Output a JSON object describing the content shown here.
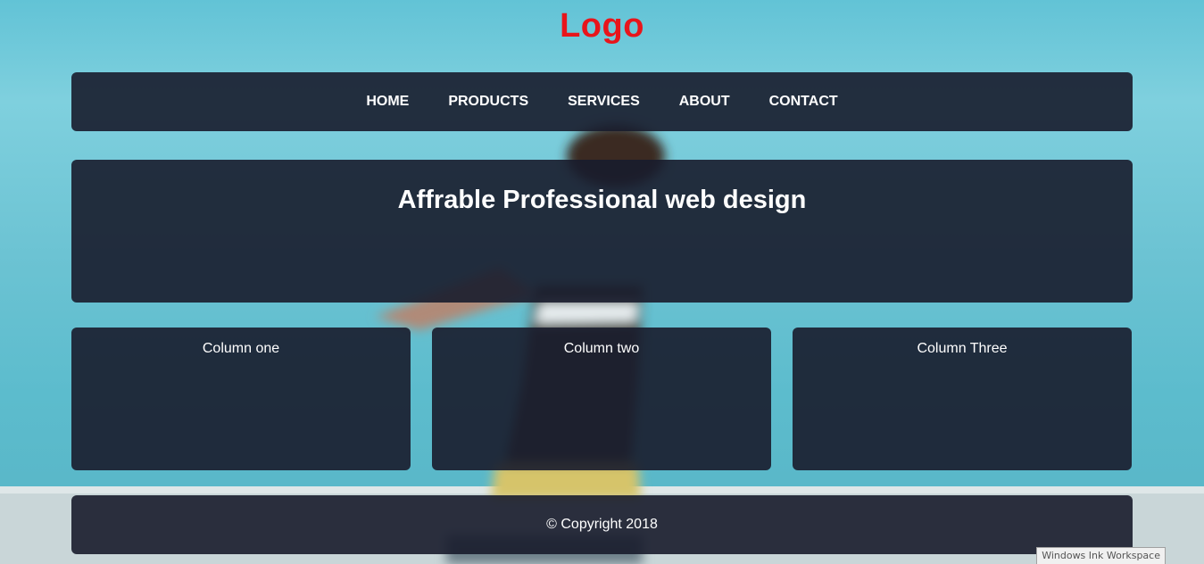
{
  "logo": {
    "text": "Logo",
    "color": "#e8151b"
  },
  "nav": {
    "items": [
      {
        "label": "HOME"
      },
      {
        "label": "PRODUCTS"
      },
      {
        "label": "SERVICES"
      },
      {
        "label": "ABOUT"
      },
      {
        "label": "CONTACT"
      }
    ]
  },
  "hero": {
    "title": "Affrable Professional web design"
  },
  "columns": [
    {
      "title": "Column one"
    },
    {
      "title": "Column two"
    },
    {
      "title": "Column Three"
    }
  ],
  "footer": {
    "text": "© Copyright 2018"
  },
  "system": {
    "tooltip": "Windows Ink Workspace"
  },
  "colors": {
    "panel": "#181c2c",
    "background": "#62c3d6",
    "text": "#ffffff"
  }
}
